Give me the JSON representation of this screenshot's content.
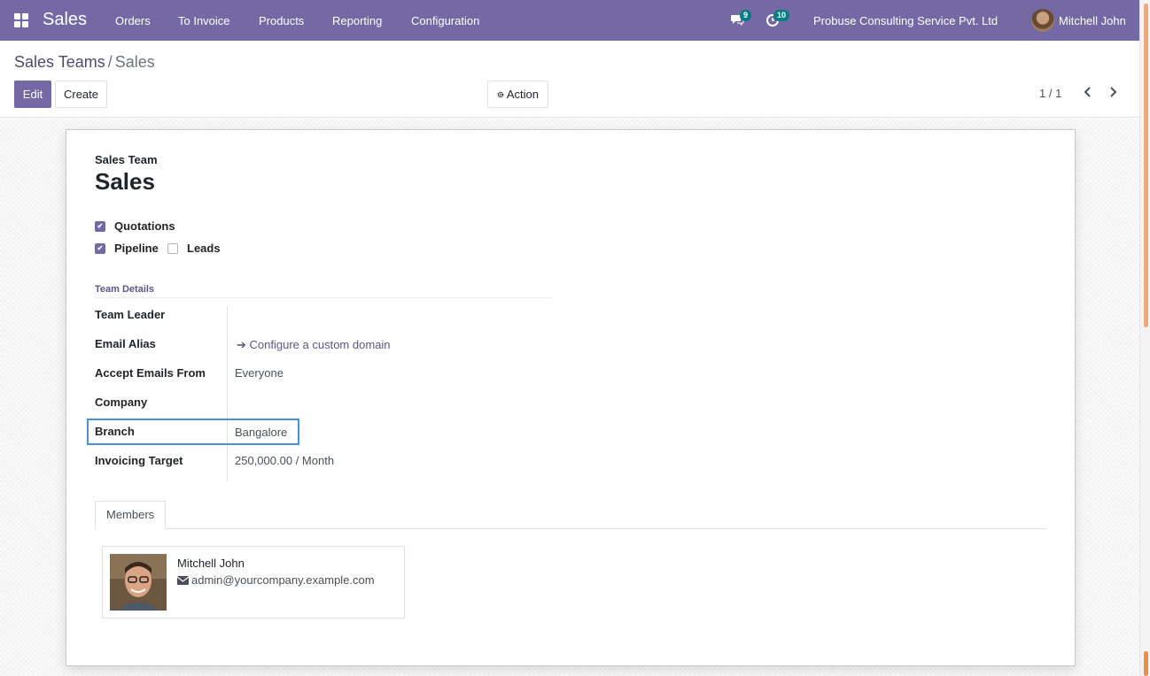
{
  "navbar": {
    "brand": "Sales",
    "menu": [
      "Orders",
      "To Invoice",
      "Products",
      "Reporting",
      "Configuration"
    ],
    "messages_badge": "9",
    "activities_badge": "10",
    "company": "Probuse Consulting Service Pvt. Ltd",
    "user": "Mitchell John"
  },
  "breadcrumb": {
    "parent": "Sales Teams",
    "separator": "/",
    "current": "Sales"
  },
  "buttons": {
    "edit": "Edit",
    "create": "Create",
    "action": "Action"
  },
  "pager": {
    "value": "1 / 1"
  },
  "form": {
    "header_label": "Sales Team",
    "name": "Sales",
    "options": {
      "quotations": {
        "label": "Quotations",
        "checked": true
      },
      "pipeline": {
        "label": "Pipeline",
        "checked": true
      },
      "leads": {
        "label": "Leads",
        "checked": false
      }
    },
    "group_title": "Team Details",
    "fields": {
      "team_leader": {
        "label": "Team Leader",
        "value": ""
      },
      "email_alias": {
        "label": "Email Alias",
        "value": "Configure a custom domain"
      },
      "accept_emails": {
        "label": "Accept Emails From",
        "value": "Everyone"
      },
      "company": {
        "label": "Company",
        "value": ""
      },
      "branch": {
        "label": "Branch",
        "value": "Bangalore"
      },
      "invoicing_target": {
        "label": "Invoicing Target",
        "value": "250,000.00",
        "unit": "/ Month"
      }
    }
  },
  "tabs": {
    "members": "Members"
  },
  "members": [
    {
      "name": "Mitchell John",
      "email": "admin@yourcompany.example.com"
    }
  ],
  "colors": {
    "brand": "#7469a5",
    "badge": "#017e84",
    "link": "#5b5785",
    "focus_border": "#4a90d9"
  }
}
